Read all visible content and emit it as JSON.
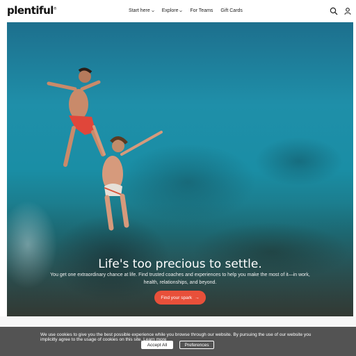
{
  "header": {
    "logo": "plentiful",
    "logo_mark": "®",
    "nav": [
      {
        "label": "Start here",
        "has_dropdown": true
      },
      {
        "label": "Explore",
        "has_dropdown": true
      },
      {
        "label": "For Teams",
        "has_dropdown": false
      },
      {
        "label": "Gift Cards",
        "has_dropdown": false
      }
    ],
    "icons": [
      "search-icon",
      "user-icon"
    ]
  },
  "hero": {
    "title": "Life's too precious to settle.",
    "subtitle": "You get one extraordinary chance at life. Find trusted coaches and experiences to help you make the most of it—in work, health, relationships, and beyond.",
    "cta": "Find your spark",
    "cta_arrow": "→",
    "accent": "#e8503a"
  },
  "cookie": {
    "text": "We use cookies to give you the best possible experience while you browse through our website. By pursuing the use of our website you implicitly agree to the usage of cookies on this site.",
    "learn_more": "Learn more",
    "accept": "Accept All",
    "preferences": "Preferences"
  }
}
